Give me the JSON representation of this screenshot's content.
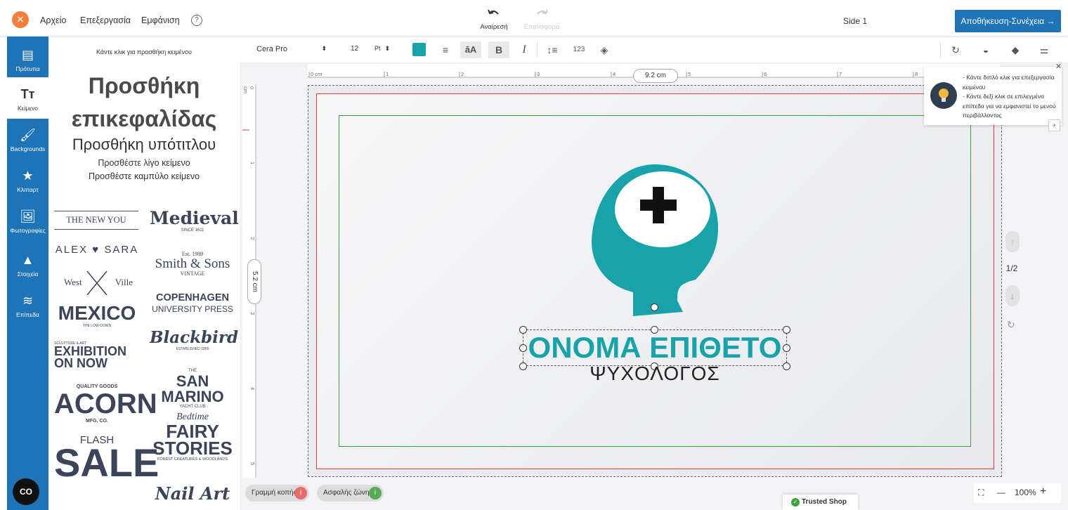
{
  "topbar": {
    "menu": [
      "Αρχείο",
      "Επεξεργασία",
      "Εμφάνιση"
    ],
    "undo_label": "Αναίρεσή",
    "redo_label": "Επανάφορά",
    "side_label": "Side 1",
    "save_label": "Αποθήκευση-Συνέχεια →"
  },
  "sidebar": {
    "items": [
      {
        "label": "Πρότυπα",
        "icon": "template-icon"
      },
      {
        "label": "Κείμενο",
        "icon": "text-icon"
      },
      {
        "label": "Backgrounds",
        "icon": "paint-roller-icon"
      },
      {
        "label": "Κλιπαρτ",
        "icon": "star-icon"
      },
      {
        "label": "Φωτογραφίες",
        "icon": "image-icon"
      },
      {
        "label": "Στοιχεία",
        "icon": "shapes-icon"
      },
      {
        "label": "Επίπεδα",
        "icon": "layers-icon"
      }
    ]
  },
  "panel": {
    "hint": "Κάντε κλικ για προσθήκη κειμένου",
    "heading": "Προσθήκη επικεφαλίδας",
    "subtitle": "Προσθήκη υπότιτλου",
    "small_text": "Προσθέστε λίγο κείμενο",
    "curved_text": "Προσθέστε καμπύλο κείμενο",
    "templates": {
      "newyou": "THE NEW YOU",
      "medieval": "Medieval",
      "medieval_sub": "SINCE 1611",
      "alex": "ALEX",
      "sara": "SARA",
      "smith_top": "Est. 1989",
      "smith": "Smith & Sons",
      "smith_bottom": "VINTAGE",
      "west": "West",
      "ville": "Ville",
      "copenhagen": "COPENHAGEN",
      "copenhagen_sub": "UNIVERSITY PRESS",
      "mexico": "MEXICO",
      "mexico_sub": "THE LOW-DOWN",
      "blackbird": "Blackbird",
      "blackbird_sub": "ESTABLISHED 1856",
      "exhib_top": "SCULPTURE & ART",
      "exhibition": "EXHIBITION",
      "on_now": "ON NOW",
      "sanmarino_top": "THE",
      "sanmarino": "SAN MARINO",
      "sanmarino_sub": "YACHT CLUB",
      "acorn_top": "QUALITY GOODS",
      "acorn": "ACORN",
      "acorn_sub": "MFG. CO.",
      "fairy_top": "Bedtime",
      "fairy": "FAIRY STORIES",
      "fairy_sub": "FOREST CREATURES & WOODLANDS",
      "flash": "FLASH",
      "sale": "SALE",
      "nailart": "Nail Art"
    }
  },
  "format": {
    "font": "Cera Pro",
    "size": "12",
    "unit": "Pt",
    "color": "#17a3a9"
  },
  "rulers": {
    "h_ticks": [
      "0 cm",
      "1",
      "2",
      "3",
      "4",
      "5",
      "6",
      "7",
      "8"
    ],
    "v_ticks": [
      "0 cm",
      "1",
      "2",
      "3",
      "4",
      "5"
    ],
    "width_tag": "9.2 cm",
    "height_tag": "5.2 cm"
  },
  "design": {
    "name": "ΟΝΟΜΑ ΕΠΙΘΕΤΟ",
    "role": "ΨΥΧΟΛΟΓΟΣ",
    "accent": "#17a3a9"
  },
  "bottom": {
    "cut_line": "Γραμμή κοπής",
    "safe_zone": "Ασφαλής ζώνη",
    "zoom": "100%",
    "trusted": "Trusted Shop"
  },
  "pages": {
    "count": "1/2"
  },
  "tip": {
    "line1": "- Κάντε διπλό κλικ για επεξεργασία κειμένου",
    "line2": "- Κάντε δεξί κλικ σε επιλεγμένα επίπεδα για να εμφανιστεί το μενού περιβάλλοντος"
  },
  "chat_label": "CO"
}
